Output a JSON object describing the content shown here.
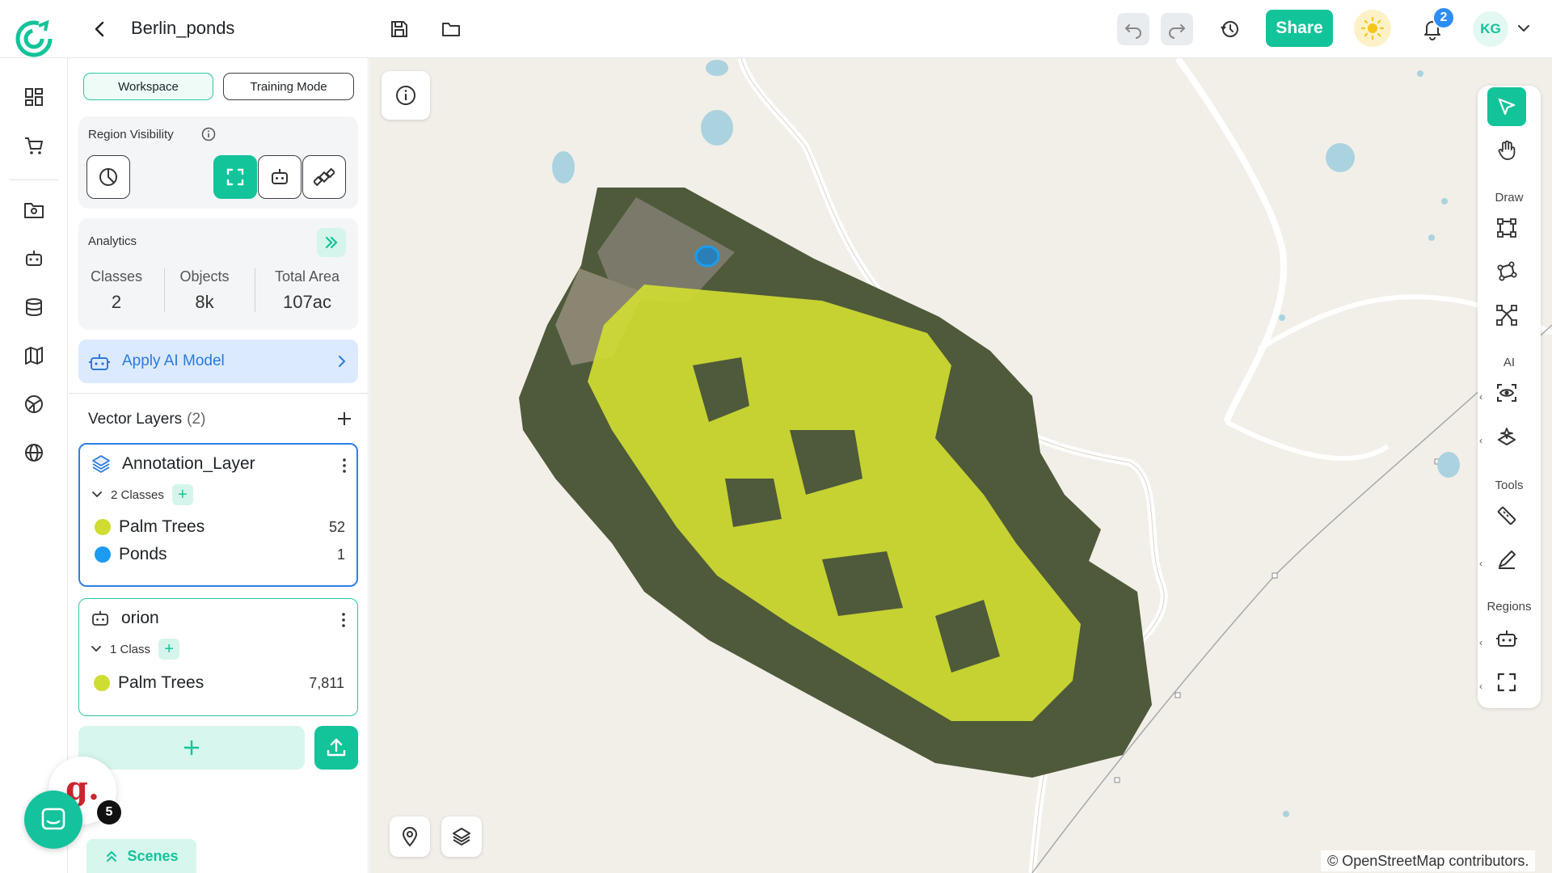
{
  "header": {
    "project_title": "Berlin_ponds",
    "share_label": "Share",
    "notification_count": "2",
    "user_initials": "KG"
  },
  "panel": {
    "modes": {
      "workspace": "Workspace",
      "training": "Training Mode"
    },
    "region_visibility": {
      "title": "Region Visibility"
    },
    "analytics": {
      "title": "Analytics",
      "stats": [
        {
          "label": "Classes",
          "value": "2"
        },
        {
          "label": "Objects",
          "value": "8k"
        },
        {
          "label": "Total Area",
          "value": "107ac"
        }
      ]
    },
    "apply_ai_label": "Apply AI Model",
    "vector_layers": {
      "title": "Vector Layers",
      "count": "(2)",
      "layers": [
        {
          "name": "Annotation_Layer",
          "class_count": "2 Classes",
          "classes": [
            {
              "name": "Palm Trees",
              "count": "52",
              "color": "#cfdc32"
            },
            {
              "name": "Ponds",
              "count": "1",
              "color": "#1b9cf0"
            }
          ]
        },
        {
          "name": "orion",
          "class_count": "1 Class",
          "classes": [
            {
              "name": "Palm Trees",
              "count": "7,811",
              "color": "#cfdc32"
            }
          ]
        }
      ]
    },
    "scenes_label": "Scenes"
  },
  "floating": {
    "chat_unread": "5",
    "g_letter": "g."
  },
  "map": {
    "attribution": "© OpenStreetMap contributors."
  },
  "toolbar": {
    "sections": {
      "draw": "Draw",
      "ai": "AI",
      "tools": "Tools",
      "regions": "Regions"
    }
  },
  "colors": {
    "accent": "#13c39a",
    "annotation": "#cfdc32",
    "pond": "#1b9cf0",
    "water": "#aad3df"
  },
  "icons": [
    "logo-icon",
    "back-icon",
    "save-icon",
    "folder-icon",
    "undo-icon",
    "redo-icon",
    "history-icon",
    "sun-icon",
    "bell-icon",
    "chevron-down-icon",
    "dashboard-icon",
    "cart-icon",
    "project-folder-icon",
    "robot-icon",
    "database-icon",
    "map-icon",
    "globe-grid-icon",
    "globe-icon",
    "pie-icon",
    "expand-icon",
    "robot-icon",
    "satellite-icon",
    "info-icon",
    "double-chevron-right-icon",
    "layers-icon",
    "kebab-icon",
    "plus-icon",
    "upload-icon",
    "location-pin-icon",
    "cursor-icon",
    "hand-icon",
    "rectangle-icon",
    "polygon-icon",
    "vertex-icon",
    "ai-eye-icon",
    "ai-segment-icon",
    "ruler-icon",
    "pen-icon"
  ]
}
